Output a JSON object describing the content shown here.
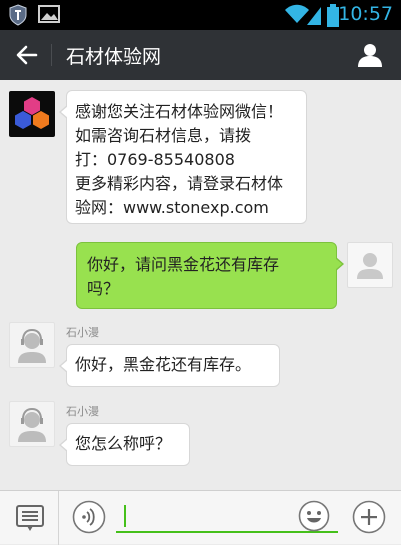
{
  "status_bar": {
    "time": "10:57",
    "icons": [
      "shield-icon",
      "image-icon",
      "wifi-icon",
      "signal-icon",
      "battery-icon"
    ]
  },
  "header": {
    "title": "石材体验网",
    "back_icon": "arrow-left-icon",
    "profile_icon": "person-icon"
  },
  "messages": [
    {
      "from": "account",
      "lines": [
        "感谢您关注石材体验网微信！",
        "如需咨询石材信息，请拨",
        "打：0769-85540808",
        "更多精彩内容，请登录石材体",
        "验网：www.stonexp.com"
      ]
    },
    {
      "from": "me",
      "lines": [
        "你好，请问黑金花还有库存",
        "吗？"
      ]
    },
    {
      "from": "agent",
      "sender": "石小漫",
      "lines": [
        "你好，黑金花还有库存。"
      ]
    },
    {
      "from": "agent",
      "sender": "石小漫",
      "lines": [
        "您怎么称呼？"
      ]
    }
  ],
  "input_bar": {
    "menu_icon": "list-menu-icon",
    "voice_icon": "voice-icon",
    "input_value": "",
    "emoji_icon": "smiley-icon",
    "plus_icon": "plus-icon"
  },
  "colors": {
    "header_bg": "#2f3236",
    "outgoing_bubble": "#98e14f",
    "incoming_bubble": "#ffffff",
    "status_accent": "#33b5e5",
    "input_underline": "#45c01a"
  }
}
